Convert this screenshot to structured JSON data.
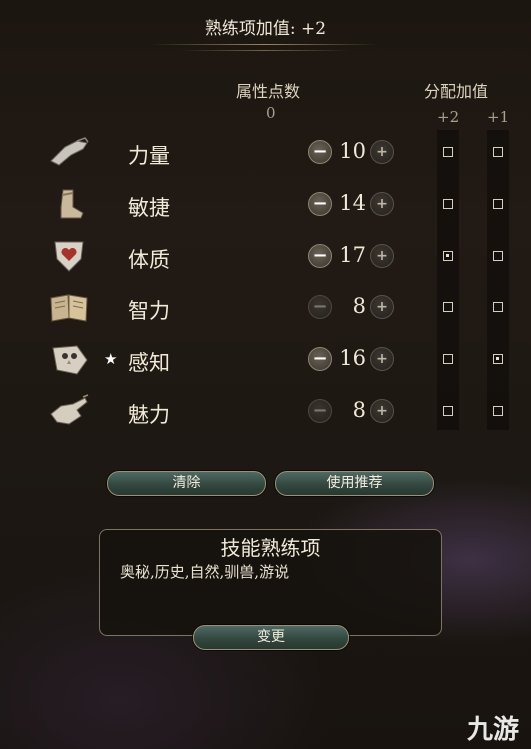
{
  "header": {
    "proficiency_bonus_text": "熟练项加值: +2"
  },
  "columns": {
    "points_title": "属性点数",
    "points_remaining": "0",
    "assign_title": "分配加值",
    "assign_plus2": "+2",
    "assign_plus1": "+1"
  },
  "abilities": [
    {
      "name": "力量",
      "value": "10",
      "icon": "gauntlet-icon",
      "starred": false,
      "minus_enabled": true,
      "plus2": false,
      "plus1": false
    },
    {
      "name": "敏捷",
      "value": "14",
      "icon": "boot-icon",
      "starred": false,
      "minus_enabled": true,
      "plus2": false,
      "plus1": false
    },
    {
      "name": "体质",
      "value": "17",
      "icon": "heart-shield-icon",
      "starred": false,
      "minus_enabled": true,
      "plus2": true,
      "plus1": false
    },
    {
      "name": "智力",
      "value": "8",
      "icon": "book-icon",
      "starred": false,
      "minus_enabled": false,
      "plus2": false,
      "plus1": false
    },
    {
      "name": "感知",
      "value": "16",
      "icon": "owl-icon",
      "starred": true,
      "star_symbol": "★",
      "minus_enabled": true,
      "plus2": false,
      "plus1": true
    },
    {
      "name": "魅力",
      "value": "8",
      "icon": "hand-icon",
      "starred": false,
      "minus_enabled": false,
      "plus2": false,
      "plus1": false
    }
  ],
  "stepper": {
    "minus_symbol": "−",
    "plus_symbol": "+"
  },
  "buttons": {
    "clear": "清除",
    "use_recommended": "使用推荐",
    "change": "变更"
  },
  "skills": {
    "title": "技能熟练项",
    "list": "奥秘,历史,自然,驯兽,游说"
  },
  "watermark": "九游",
  "colors": {
    "button_teal": "#33483f",
    "border_gold": "#9a9175",
    "text": "#efe8d8"
  }
}
